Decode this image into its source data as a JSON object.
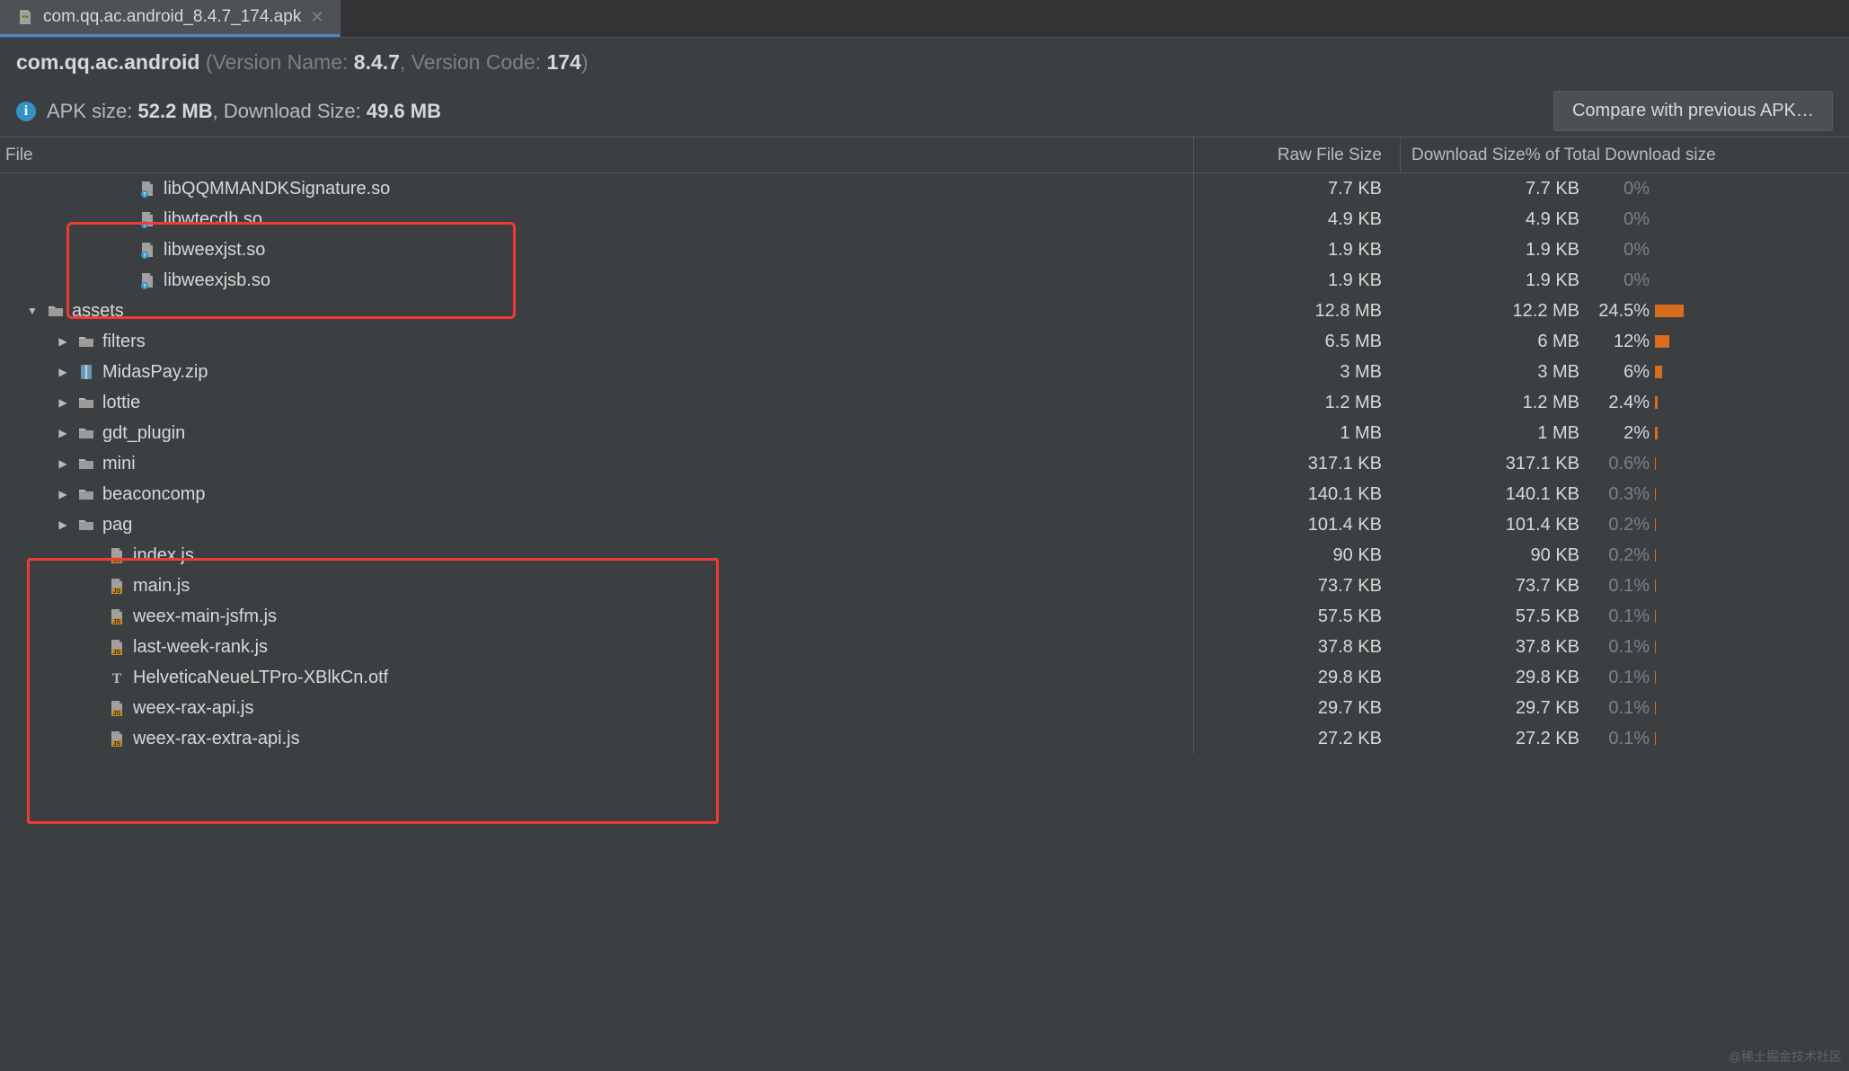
{
  "tab": {
    "label": "com.qq.ac.android_8.4.7_174.apk"
  },
  "header": {
    "packageBold": "com.qq.ac.android",
    "versionNameLabel": " (Version Name: ",
    "versionName": "8.4.7",
    "versionCodeLabel": ", Version Code: ",
    "versionCode": "174",
    "closingParen": ")",
    "apkSizeLabel": "APK size: ",
    "apkSize": "52.2 MB",
    "dlSizeSep": ", Download Size: ",
    "dlSize": "49.6 MB",
    "compareButton": "Compare with previous APK…"
  },
  "columns": {
    "file": "File",
    "raw": "Raw File Size",
    "right": "Download Size% of Total Download size"
  },
  "rows": [
    {
      "indent": 3,
      "icon": "unknown",
      "name": "libQQMMANDKSignature.so",
      "raw": "7.7 KB",
      "dl": "7.7 KB",
      "pct": "0%",
      "barPct": 0
    },
    {
      "indent": 3,
      "icon": "unknown",
      "name": "libwtecdh.so",
      "raw": "4.9 KB",
      "dl": "4.9 KB",
      "pct": "0%",
      "barPct": 0
    },
    {
      "indent": 3,
      "icon": "unknown",
      "name": "libweexjst.so",
      "raw": "1.9 KB",
      "dl": "1.9 KB",
      "pct": "0%",
      "barPct": 0
    },
    {
      "indent": 3,
      "icon": "unknown",
      "name": "libweexjsb.so",
      "raw": "1.9 KB",
      "dl": "1.9 KB",
      "pct": "0%",
      "barPct": 0
    },
    {
      "indent": 0,
      "expander": "open",
      "icon": "folder",
      "name": "assets",
      "raw": "12.8 MB",
      "dl": "12.2 MB",
      "pct": "24.5%",
      "barPct": 24.5,
      "dim": false
    },
    {
      "indent": 1,
      "expander": "closed",
      "icon": "folder",
      "name": "filters",
      "raw": "6.5 MB",
      "dl": "6 MB",
      "pct": "12%",
      "barPct": 12
    },
    {
      "indent": 1,
      "expander": "closed",
      "icon": "zip",
      "name": "MidasPay.zip",
      "raw": "3 MB",
      "dl": "3 MB",
      "pct": "6%",
      "barPct": 6
    },
    {
      "indent": 1,
      "expander": "closed",
      "icon": "folder",
      "name": "lottie",
      "raw": "1.2 MB",
      "dl": "1.2 MB",
      "pct": "2.4%",
      "barPct": 2.4
    },
    {
      "indent": 1,
      "expander": "closed",
      "icon": "folder",
      "name": "gdt_plugin",
      "raw": "1 MB",
      "dl": "1 MB",
      "pct": "2%",
      "barPct": 2
    },
    {
      "indent": 1,
      "expander": "closed",
      "icon": "folder",
      "name": "mini",
      "raw": "317.1 KB",
      "dl": "317.1 KB",
      "pct": "0.6%",
      "barPct": 0.6
    },
    {
      "indent": 1,
      "expander": "closed",
      "icon": "folder",
      "name": "beaconcomp",
      "raw": "140.1 KB",
      "dl": "140.1 KB",
      "pct": "0.3%",
      "barPct": 0.3
    },
    {
      "indent": 1,
      "expander": "closed",
      "icon": "folder",
      "name": "pag",
      "raw": "101.4 KB",
      "dl": "101.4 KB",
      "pct": "0.2%",
      "barPct": 0.2
    },
    {
      "indent": 2,
      "icon": "js",
      "name": "index.js",
      "raw": "90 KB",
      "dl": "90 KB",
      "pct": "0.2%",
      "barPct": 0.2
    },
    {
      "indent": 2,
      "icon": "js",
      "name": "main.js",
      "raw": "73.7 KB",
      "dl": "73.7 KB",
      "pct": "0.1%",
      "barPct": 0.1
    },
    {
      "indent": 2,
      "icon": "js",
      "name": "weex-main-jsfm.js",
      "raw": "57.5 KB",
      "dl": "57.5 KB",
      "pct": "0.1%",
      "barPct": 0.1
    },
    {
      "indent": 2,
      "icon": "js",
      "name": "last-week-rank.js",
      "raw": "37.8 KB",
      "dl": "37.8 KB",
      "pct": "0.1%",
      "barPct": 0.1
    },
    {
      "indent": 2,
      "icon": "font",
      "name": "HelveticaNeueLTPro-XBlkCn.otf",
      "raw": "29.8 KB",
      "dl": "29.8 KB",
      "pct": "0.1%",
      "barPct": 0.1
    },
    {
      "indent": 2,
      "icon": "js",
      "name": "weex-rax-api.js",
      "raw": "29.7 KB",
      "dl": "29.7 KB",
      "pct": "0.1%",
      "barPct": 0.1
    },
    {
      "indent": 2,
      "icon": "js",
      "name": "weex-rax-extra-api.js",
      "raw": "27.2 KB",
      "dl": "27.2 KB",
      "pct": "0.1%",
      "barPct": 0.1
    }
  ],
  "watermark": "@稀土掘金技术社区"
}
